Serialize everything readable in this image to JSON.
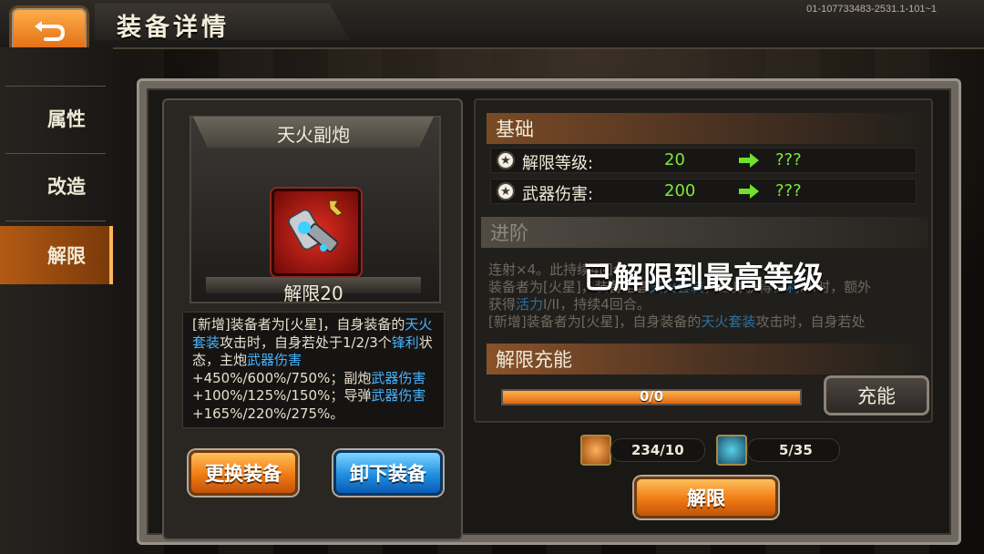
{
  "header": {
    "title": "装备详情",
    "build_id": "01-107733483-2531.1-101~1"
  },
  "sidebar": {
    "tabs": [
      {
        "label": "属性"
      },
      {
        "label": "改造"
      },
      {
        "label": "解限",
        "active": true
      }
    ]
  },
  "equipment": {
    "name": "天火副炮",
    "limit_level": "解限20",
    "icon": "cannon-icon",
    "description": [
      {
        "t": "[新增]装备者为[火星]，自身装备的",
        "hl": false
      },
      {
        "t": "天火套装",
        "hl": true
      },
      {
        "t": "攻击时，自身若处于1/2/3个",
        "hl": false
      },
      {
        "t": "锋利",
        "hl": true
      },
      {
        "t": "状态，主炮",
        "hl": false
      },
      {
        "t": "武器伤害",
        "hl": true
      },
      {
        "t": "+450%/600%/750%；副炮",
        "hl": false
      },
      {
        "t": "武器伤害",
        "hl": true
      },
      {
        "t": "+100%/125%/150%；导弹",
        "hl": false
      },
      {
        "t": "武器伤害",
        "hl": true
      },
      {
        "t": "+165%/220%/275%。",
        "hl": false
      }
    ],
    "buttons": {
      "replace": "更换装备",
      "unequip": "卸下装备"
    }
  },
  "base": {
    "title": "基础",
    "stats": [
      {
        "label": "解限等级:",
        "value": "20",
        "next": "???"
      },
      {
        "label": "武器伤害:",
        "value": "200",
        "next": "???"
      }
    ]
  },
  "advance": {
    "title": "进阶",
    "lines": [
      [
        {
          "t": "连射×4。此",
          "hl": false
        },
        {
          "t": "",
          "hl": false
        },
        {
          "t": "持续4回合。",
          "hl": false
        }
      ],
      [
        {
          "t": "装备者为[火星]，装备全套",
          "hl": false
        },
        {
          "t": "天火套装",
          "hl": true
        },
        {
          "t": "，自身获得",
          "hl": false
        },
        {
          "t": "锋利",
          "hl": true
        },
        {
          "t": "I/II时，额外",
          "hl": false
        }
      ],
      [
        {
          "t": "获得",
          "hl": false
        },
        {
          "t": "活力",
          "hl": true
        },
        {
          "t": "I/II，持续4回合。",
          "hl": false
        }
      ],
      [
        {
          "t": "[新增]装备者为[火星]，自身装备的",
          "hl": false
        },
        {
          "t": "天火套装",
          "hl": true
        },
        {
          "t": "攻击时，自身若处",
          "hl": false
        }
      ]
    ],
    "overlay": "已解限到最高等级"
  },
  "charge": {
    "title": "解限充能",
    "progress_text": "0/0",
    "progress": 1.0,
    "button": "充能"
  },
  "resources": [
    {
      "icon": "armor-part-icon",
      "value": "234/10"
    },
    {
      "icon": "tank-chip-icon",
      "value": "5/35"
    }
  ],
  "actions": {
    "unlock": "解限"
  },
  "colors": {
    "accent": "#f07a12",
    "value_green": "#7ee83d",
    "highlight_blue": "#46b3ff"
  }
}
